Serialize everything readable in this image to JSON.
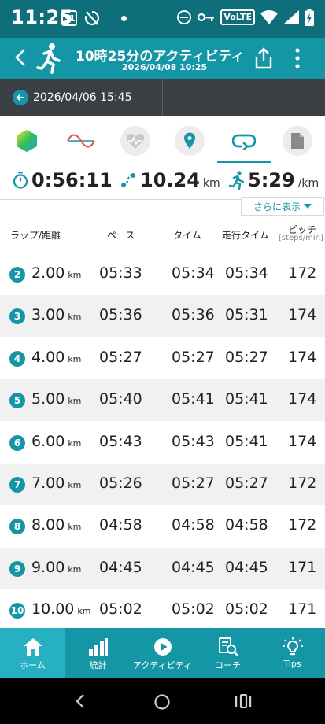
{
  "status_bar": {
    "time": "11:25",
    "calendar_day": "31",
    "network": "VoLTE"
  },
  "app_bar": {
    "title": "10時25分のアクティビティ",
    "subtitle": "2026/04/08 10:25"
  },
  "compare": {
    "date": "2026/04/06 15:45"
  },
  "tabs": [
    "overview-tab",
    "graph-tab",
    "heart-rate-tab",
    "map-tab",
    "laps-tab",
    "notes-tab"
  ],
  "summary": {
    "time": "0:56:11",
    "distance": "10.24",
    "distance_unit": "km",
    "pace": "5:29",
    "pace_unit": "/km"
  },
  "more_button": "さらに表示",
  "table": {
    "headers": {
      "lap": "ラップ/距離",
      "pace": "ペース",
      "time": "タイム",
      "run_time": "走行タイム",
      "pitch": "ピッチ",
      "pitch_unit": "[steps/min]"
    },
    "rows": [
      {
        "n": "2",
        "dist": "2.00",
        "unit": "km",
        "pace": "05:33",
        "time": "05:34",
        "run": "05:34",
        "pitch": "172"
      },
      {
        "n": "3",
        "dist": "3.00",
        "unit": "km",
        "pace": "05:36",
        "time": "05:36",
        "run": "05:31",
        "pitch": "174"
      },
      {
        "n": "4",
        "dist": "4.00",
        "unit": "km",
        "pace": "05:27",
        "time": "05:27",
        "run": "05:27",
        "pitch": "174"
      },
      {
        "n": "5",
        "dist": "5.00",
        "unit": "km",
        "pace": "05:40",
        "time": "05:41",
        "run": "05:41",
        "pitch": "174"
      },
      {
        "n": "6",
        "dist": "6.00",
        "unit": "km",
        "pace": "05:43",
        "time": "05:43",
        "run": "05:41",
        "pitch": "174"
      },
      {
        "n": "7",
        "dist": "7.00",
        "unit": "km",
        "pace": "05:26",
        "time": "05:27",
        "run": "05:27",
        "pitch": "172"
      },
      {
        "n": "8",
        "dist": "8.00",
        "unit": "km",
        "pace": "04:58",
        "time": "04:58",
        "run": "04:58",
        "pitch": "172"
      },
      {
        "n": "9",
        "dist": "9.00",
        "unit": "km",
        "pace": "04:45",
        "time": "04:45",
        "run": "04:45",
        "pitch": "171"
      },
      {
        "n": "10",
        "dist": "10.00",
        "unit": "km",
        "pace": "05:02",
        "time": "05:02",
        "run": "05:02",
        "pitch": "171"
      }
    ]
  },
  "bottom_nav": [
    {
      "label": "ホーム",
      "icon": "home-icon",
      "active": true
    },
    {
      "label": "統計",
      "icon": "bar-chart-icon",
      "active": false
    },
    {
      "label": "アクティビティ",
      "icon": "play-icon",
      "active": false
    },
    {
      "label": "コーチ",
      "icon": "coach-icon",
      "active": false
    },
    {
      "label": "Tips",
      "icon": "lightbulb-icon",
      "active": false
    }
  ],
  "colors": {
    "statusbar": "#0e6f7b",
    "accent": "#1596a6",
    "compare_bar": "#3b3e43"
  }
}
